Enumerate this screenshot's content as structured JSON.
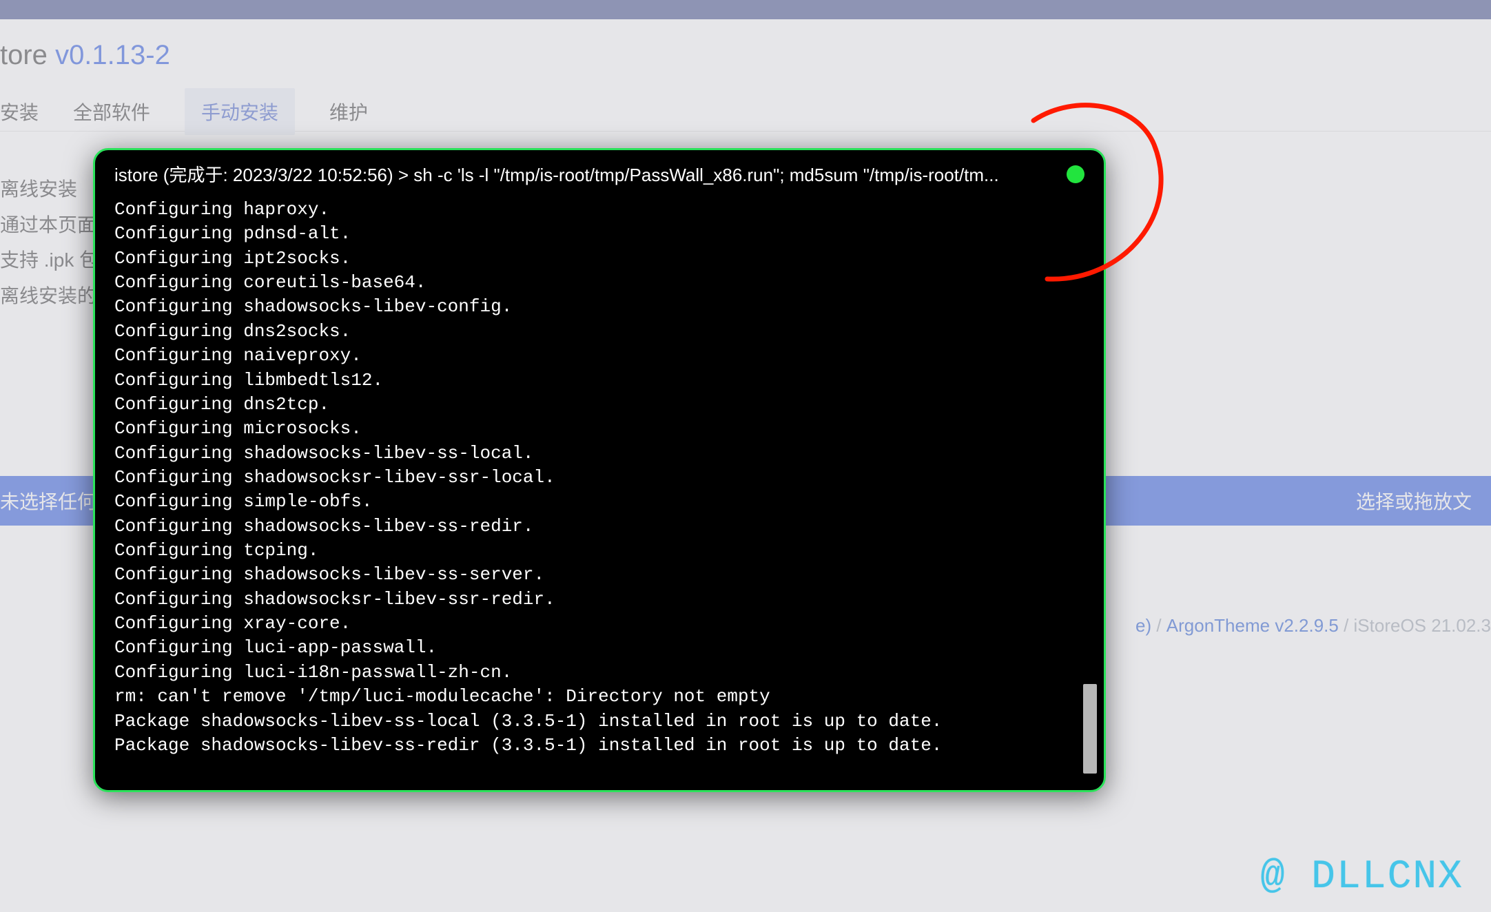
{
  "header": {
    "app_name": "tore",
    "version": "v0.1.13-2"
  },
  "tabs": {
    "t0": "安装",
    "t1": "全部软件",
    "t2": "手动安装",
    "t3": "维护"
  },
  "help": {
    "l0": "离线安装",
    "l1": "通过本页面",
    "l2": "支持 .ipk 包",
    "l3": "离线安装的"
  },
  "upload": {
    "left": "未选择任何文",
    "right": "选择或拖放文"
  },
  "footer": {
    "seg1_suffix": "e)",
    "sep": " / ",
    "theme": "ArgonTheme v2.2.9.5",
    "os": "iStoreOS 21.02.3"
  },
  "terminal": {
    "title": "istore (完成于:    2023/3/22 10:52:56) > sh -c 'ls -l \"/tmp/is-root/tmp/PassWall_x86.run\"; md5sum \"/tmp/is-root/tm...",
    "lines": [
      "Configuring haproxy.",
      "Configuring pdnsd-alt.",
      "Configuring ipt2socks.",
      "Configuring coreutils-base64.",
      "Configuring shadowsocks-libev-config.",
      "Configuring dns2socks.",
      "Configuring naiveproxy.",
      "Configuring libmbedtls12.",
      "Configuring dns2tcp.",
      "Configuring microsocks.",
      "Configuring shadowsocks-libev-ss-local.",
      "Configuring shadowsocksr-libev-ssr-local.",
      "Configuring simple-obfs.",
      "Configuring shadowsocks-libev-ss-redir.",
      "Configuring tcping.",
      "Configuring shadowsocks-libev-ss-server.",
      "Configuring shadowsocksr-libev-ssr-redir.",
      "Configuring xray-core.",
      "Configuring luci-app-passwall.",
      "Configuring luci-i18n-passwall-zh-cn.",
      "rm: can't remove '/tmp/luci-modulecache': Directory not empty",
      "Package shadowsocks-libev-ss-local (3.3.5-1) installed in root is up to date.",
      "Package shadowsocks-libev-ss-redir (3.3.5-1) installed in root is up to date."
    ]
  },
  "watermark": "@ DLLCNX"
}
